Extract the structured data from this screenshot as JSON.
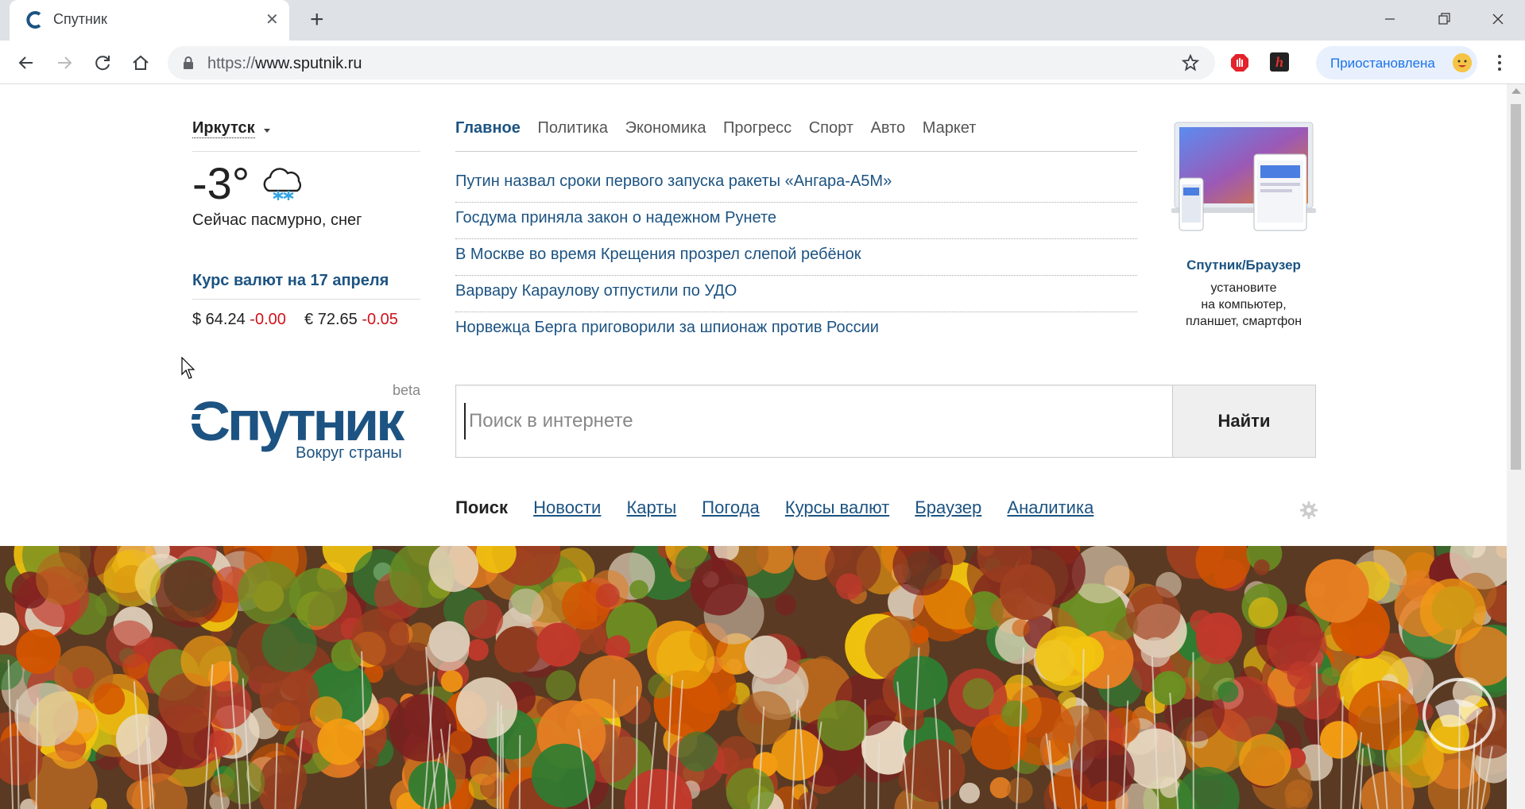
{
  "browser": {
    "tab_title": "Спутник",
    "url_scheme": "https://",
    "url_host": "www.sputnik.ru",
    "profile_label": "Приостановлена"
  },
  "weather": {
    "city": "Иркутск",
    "temperature": "-3°",
    "description": "Сейчас пасмурно, снег",
    "icon": "cloud-snow-icon"
  },
  "rates": {
    "title": "Курс валют на 17 апреля",
    "usd_value": "$ 64.24",
    "usd_change": "-0.00",
    "eur_value": "€ 72.65",
    "eur_change": "-0.05"
  },
  "logo": {
    "name": "Спутник",
    "beta": "beta",
    "tagline": "Вокруг страны"
  },
  "menu": [
    {
      "label": "Главное",
      "active": true
    },
    {
      "label": "Политика"
    },
    {
      "label": "Экономика"
    },
    {
      "label": "Прогресс"
    },
    {
      "label": "Спорт"
    },
    {
      "label": "Авто"
    },
    {
      "label": "Маркет"
    }
  ],
  "news": [
    "Путин назвал сроки первого запуска ракеты «Ангара-А5М»",
    "Госдума приняла закон о надежном Рунете",
    "В Москве во время Крещения прозрел слепой ребёнок",
    "Варвару Караулову отпустили по УДО",
    "Норвежца Берга приговорили за шпионаж против России"
  ],
  "promo": {
    "title": "Спутник/Браузер",
    "line1": "установите",
    "line2": "на компьютер,",
    "line3": "планшет, смартфон"
  },
  "search": {
    "placeholder": "Поиск в интернете",
    "button": "Найти"
  },
  "services": [
    {
      "label": "Поиск",
      "active": true
    },
    {
      "label": "Новости"
    },
    {
      "label": "Карты"
    },
    {
      "label": "Погода"
    },
    {
      "label": "Курсы валют"
    },
    {
      "label": "Браузер"
    },
    {
      "label": "Аналитика"
    }
  ],
  "colors": {
    "link": "#1c5382",
    "negative": "#d0121c",
    "brand": "#1c5382"
  }
}
